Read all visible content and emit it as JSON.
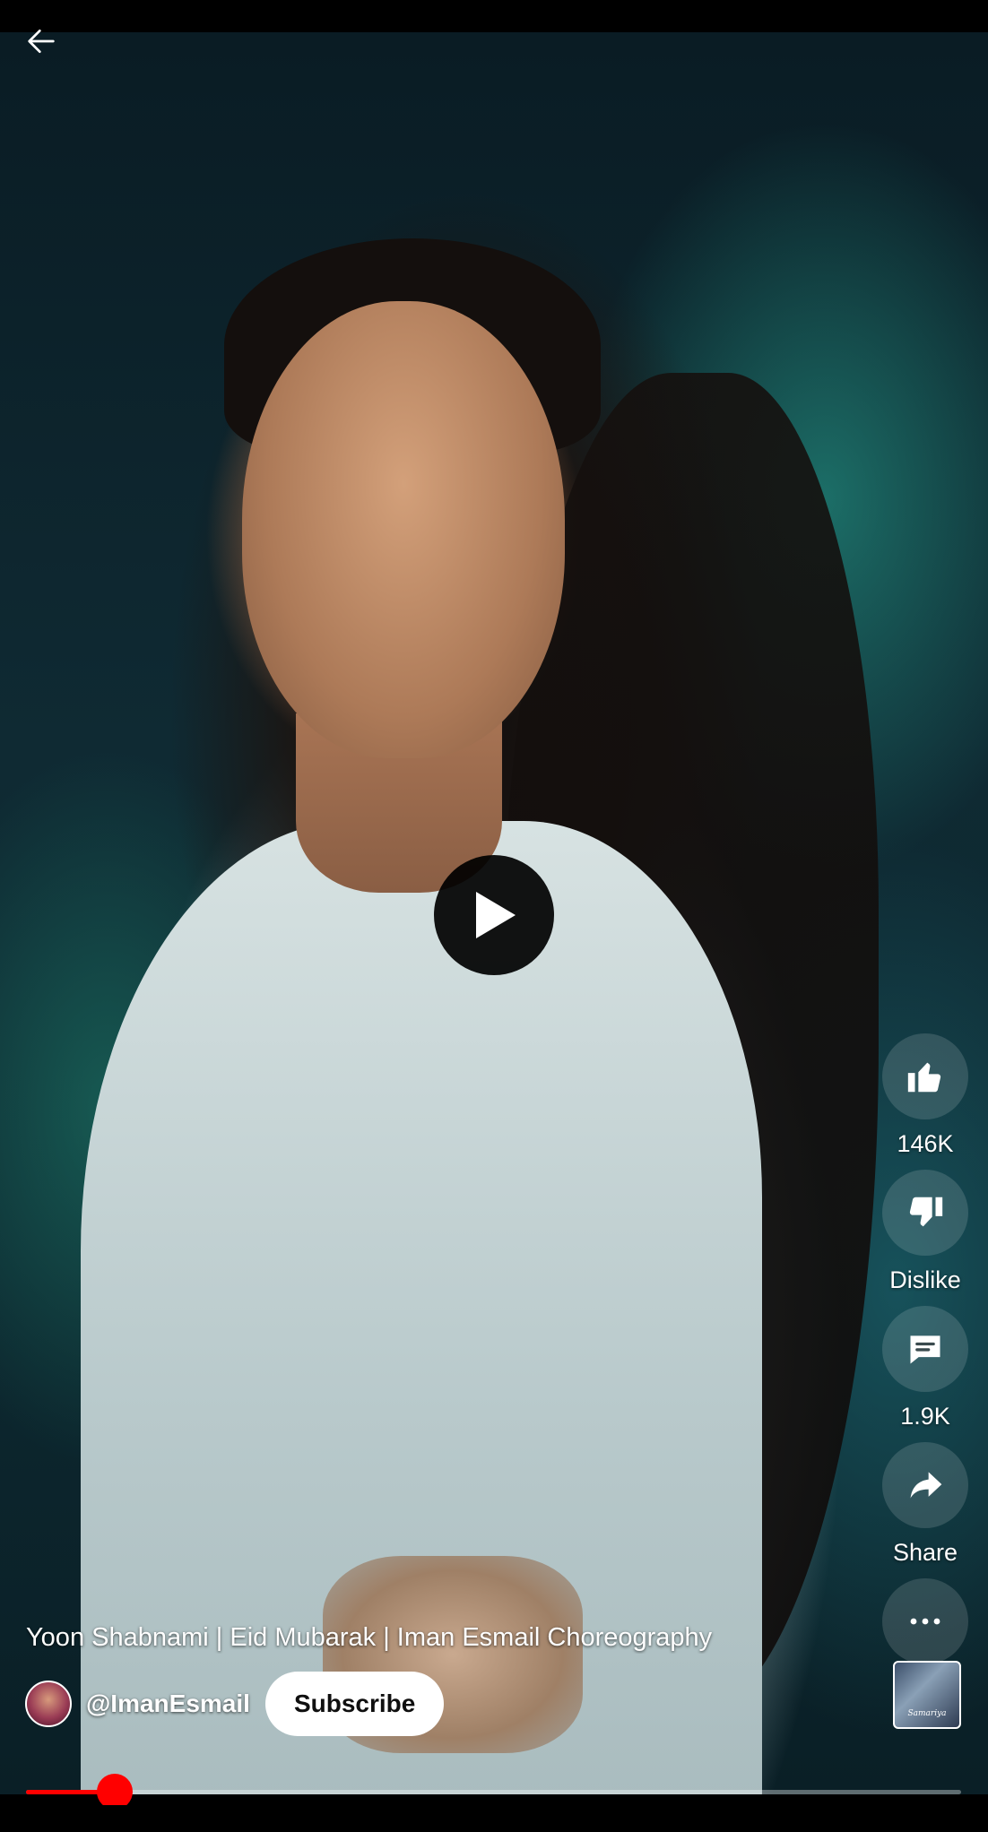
{
  "video": {
    "title": "Yoon Shabnami | Eid Mubarak | Iman Esmail Choreography",
    "paused": true,
    "progress": 0.095
  },
  "channel": {
    "handle": "@ImanEsmail",
    "subscribe_label": "Subscribe"
  },
  "actions": {
    "like": {
      "icon": "thumbs-up-icon",
      "label": "146K"
    },
    "dislike": {
      "icon": "thumbs-down-icon",
      "label": "Dislike"
    },
    "comments": {
      "icon": "comment-icon",
      "label": "1.9K"
    },
    "share": {
      "icon": "share-icon",
      "label": "Share"
    },
    "more": {
      "icon": "more-horizontal-icon"
    }
  },
  "sound": {
    "thumbnail_text": "Samariya"
  },
  "colors": {
    "accent": "#ff0000",
    "subscribe_bg": "#ffffff",
    "subscribe_text": "#0f0f0f"
  }
}
